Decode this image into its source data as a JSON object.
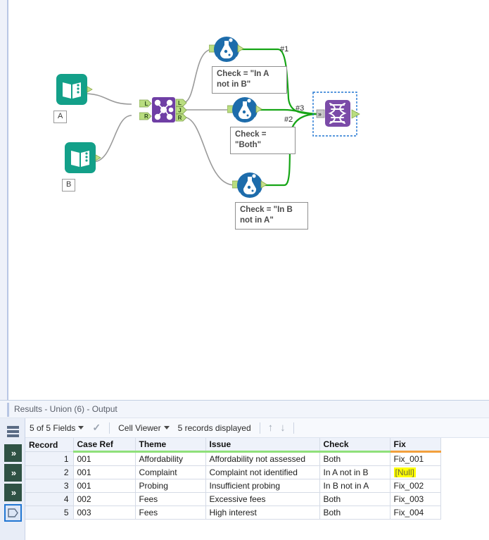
{
  "app": {
    "name": "alteryx-designer"
  },
  "canvas": {
    "nodes": [
      {
        "id": "input-a",
        "type": "input-data-icon",
        "label": "A"
      },
      {
        "id": "input-b",
        "type": "input-data-icon",
        "label": "B"
      },
      {
        "id": "join",
        "type": "join-icon",
        "inputs": [
          "L",
          "R"
        ],
        "outputs": [
          "L",
          "J",
          "R"
        ]
      },
      {
        "id": "formula-1",
        "type": "formula-icon",
        "annotation": "Check = \"In A not in B\""
      },
      {
        "id": "formula-2",
        "type": "formula-icon",
        "annotation": "Check = \"Both\""
      },
      {
        "id": "formula-3",
        "type": "formula-icon",
        "annotation": "Check = \"In B not in A\""
      },
      {
        "id": "union",
        "type": "union-icon",
        "selected": true
      }
    ],
    "connection_labels": [
      "#1",
      "#3",
      "#2"
    ],
    "colors": {
      "input_tool": "#13a089",
      "join_tool": "#6f3fa5",
      "formula_tool": "#1d6cab",
      "union_tool": "#7b4ba8",
      "anchor": "#a9d46a",
      "wire_selected": "#16a516",
      "wire": "#9a9a9a",
      "selection_border": "#2176d2"
    }
  },
  "results": {
    "title": "Results - Union (6) - Output",
    "toolbar": {
      "fields_label": "5 of 5 Fields",
      "check_icon": "check-icon",
      "viewer_label": "Cell Viewer",
      "records_label": "5 records displayed",
      "up_icon": "arrow-up-icon",
      "down_icon": "arrow-down-icon"
    },
    "rail": {
      "items": [
        {
          "name": "rail-grid",
          "icon": "grid-icon"
        },
        {
          "name": "rail-chevron-1",
          "icon": "chevrons-right-icon",
          "glyph": "»"
        },
        {
          "name": "rail-chevron-2",
          "icon": "chevrons-right-icon",
          "glyph": "»"
        },
        {
          "name": "rail-chevron-3",
          "icon": "chevrons-right-icon",
          "glyph": "»"
        },
        {
          "name": "rail-polygon",
          "icon": "polygon-icon",
          "glyph": "⬠",
          "selected": true
        }
      ]
    },
    "table": {
      "columns": [
        "Record",
        "Case Ref",
        "Theme",
        "Issue",
        "Check",
        "Fix"
      ],
      "rows": [
        {
          "record": "1",
          "case_ref": "001",
          "theme": "Affordability",
          "issue": "Affordability not assessed",
          "check": "Both",
          "fix": "Fix_001",
          "fix_null": false
        },
        {
          "record": "2",
          "case_ref": "001",
          "theme": "Complaint",
          "issue": "Complaint not identified",
          "check": "In A not in B",
          "fix": "[Null]",
          "fix_null": true
        },
        {
          "record": "3",
          "case_ref": "001",
          "theme": "Probing",
          "issue": "Insufficient probing",
          "check": "In B not in A",
          "fix": "Fix_002",
          "fix_null": false
        },
        {
          "record": "4",
          "case_ref": "002",
          "theme": "Fees",
          "issue": "Excessive fees",
          "check": "Both",
          "fix": "Fix_003",
          "fix_null": false
        },
        {
          "record": "5",
          "case_ref": "003",
          "theme": "Fees",
          "issue": "High interest",
          "check": "Both",
          "fix": "Fix_004",
          "fix_null": false
        }
      ]
    }
  }
}
